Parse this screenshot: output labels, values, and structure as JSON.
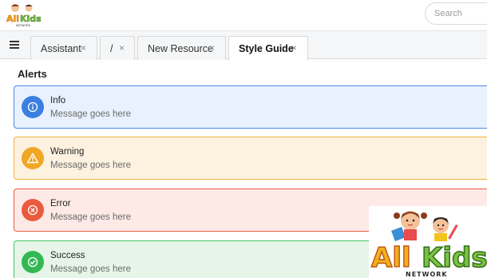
{
  "header": {
    "logo_text": "AllKids",
    "logo_subtext": "NETWORK",
    "search_placeholder": "Search"
  },
  "tabs": [
    {
      "label": "Assistant",
      "close": "×"
    },
    {
      "label": "/",
      "close": "×"
    },
    {
      "label": "New Resource",
      "close": "×"
    },
    {
      "label": "Style Guide",
      "close": "×",
      "active": true
    }
  ],
  "main": {
    "section_title": "Alerts",
    "alerts": [
      {
        "type": "info",
        "title": "Info",
        "message": "Message goes here",
        "color": "#3b7fe0"
      },
      {
        "type": "warning",
        "title": "Warning",
        "message": "Message goes here",
        "color": "#f0a724"
      },
      {
        "type": "error",
        "title": "Error",
        "message": "Message goes here",
        "color": "#ea5a3d"
      },
      {
        "type": "success",
        "title": "Success",
        "message": "Message goes here",
        "color": "#33b853"
      }
    ]
  },
  "icons": [
    "menu-icon",
    "info-icon",
    "warning-icon",
    "error-icon",
    "success-icon",
    "close-icon"
  ],
  "watermark": {
    "logo_text": "AllKids",
    "logo_subtext": "NETWORK"
  }
}
